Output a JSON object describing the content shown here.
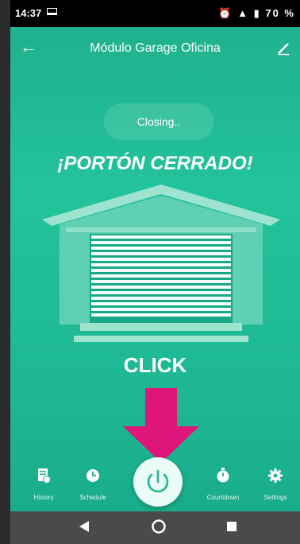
{
  "status": {
    "time": "14:37",
    "battery": "70 %"
  },
  "appbar": {
    "title": "Módulo Garage Oficina",
    "back_icon": "back-arrow-icon",
    "edit_icon": "edit-pencil-icon"
  },
  "device": {
    "state_text": "Closing.."
  },
  "overlay": {
    "headline": "¡PORTÓN CERRADO!",
    "click": "CLICK",
    "arrow_color": "#e0157a"
  },
  "tabs": [
    {
      "label": "History",
      "icon": "history-icon"
    },
    {
      "label": "Schedule",
      "icon": "clock-icon"
    },
    {
      "label": "Countdown",
      "icon": "stopwatch-icon"
    },
    {
      "label": "Settings",
      "icon": "gear-icon"
    }
  ],
  "power": {
    "icon": "power-icon"
  },
  "colors": {
    "accent": "#22c39c",
    "navbar": "#4a4a4a"
  }
}
